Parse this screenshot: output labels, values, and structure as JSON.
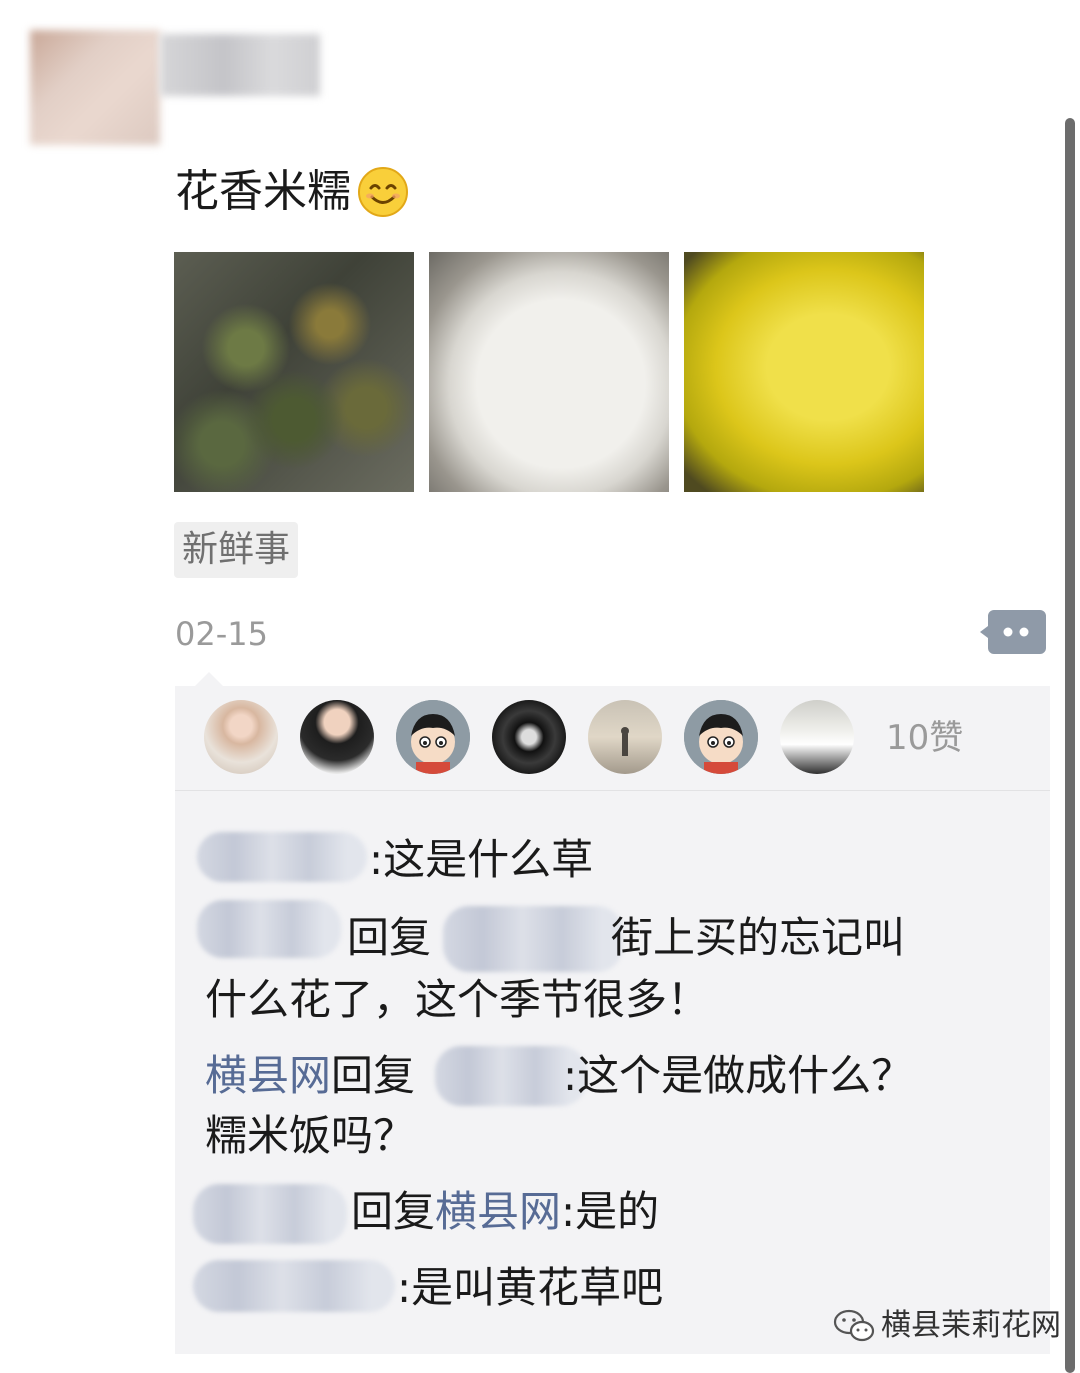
{
  "post": {
    "text": "花香米糯",
    "emoji": "smile-emoji",
    "tag": "新鲜事",
    "date": "02-15"
  },
  "likes": {
    "count_label": "10赞",
    "avatars": [
      "avatar-1",
      "avatar-2",
      "avatar-3",
      "avatar-4",
      "avatar-5",
      "avatar-6",
      "avatar-7"
    ]
  },
  "comments": {
    "c1_text": ":这是什么草",
    "c2_reply": "回复",
    "c2_text_a": "街上买的忘记叫",
    "c2_text_b": "什么花了，这个季节很多！",
    "c3_author": "横县网",
    "c3_reply": "回复",
    "c3_text_a": ":这个是做成什么？",
    "c3_text_b": "糯米饭吗？",
    "c4_reply": "回复",
    "c4_target": "横县网",
    "c4_text": ":是的",
    "c5_text": ":是叫黄花草吧"
  },
  "watermark": {
    "text": "横县茉莉花网",
    "icon": "wechat-icon"
  },
  "colors": {
    "link": "#576b95",
    "panel": "#f3f3f5",
    "date": "#9a9a9a"
  }
}
